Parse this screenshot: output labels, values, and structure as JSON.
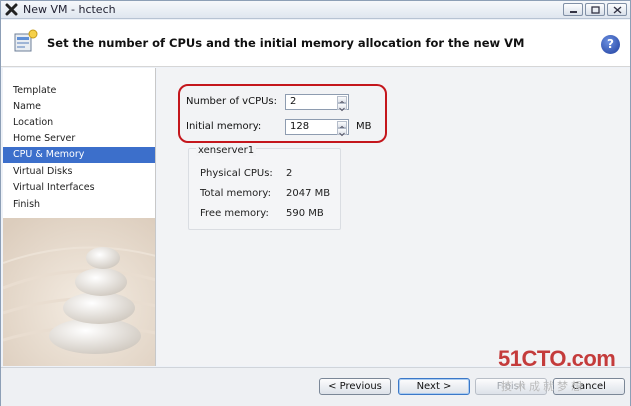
{
  "window": {
    "title": "New VM - hctech"
  },
  "header": {
    "title": "Set the number of CPUs and the initial memory allocation for the new VM",
    "help_icon": "question-mark-icon",
    "wizard_icon": "vm-wizard-icon"
  },
  "sidebar": {
    "items": [
      {
        "label": "Template",
        "active": false
      },
      {
        "label": "Name",
        "active": false
      },
      {
        "label": "Location",
        "active": false
      },
      {
        "label": "Home Server",
        "active": false
      },
      {
        "label": "CPU & Memory",
        "active": true
      },
      {
        "label": "Virtual Disks",
        "active": false
      },
      {
        "label": "Virtual Interfaces",
        "active": false
      },
      {
        "label": "Finish",
        "active": false
      }
    ]
  },
  "form": {
    "vcpus_label": "Number of vCPUs:",
    "vcpus_value": "2",
    "memory_label": "Initial memory:",
    "memory_value": "128",
    "memory_unit": "MB"
  },
  "server": {
    "name": "xenserver1",
    "physical_cpus_label": "Physical CPUs:",
    "physical_cpus_value": "2",
    "total_memory_label": "Total memory:",
    "total_memory_value": "2047 MB",
    "free_memory_label": "Free memory:",
    "free_memory_value": "590 MB"
  },
  "footer": {
    "previous_label": "< Previous",
    "next_label": "Next >",
    "finish_label": "Finish",
    "cancel_label": "Cancel"
  },
  "watermark": {
    "text": "51CTO.com",
    "subtext": "技术成就梦想"
  },
  "colors": {
    "accent": "#3c6fcb",
    "highlight": "#c4161c",
    "watermark": "#c43b3b"
  }
}
